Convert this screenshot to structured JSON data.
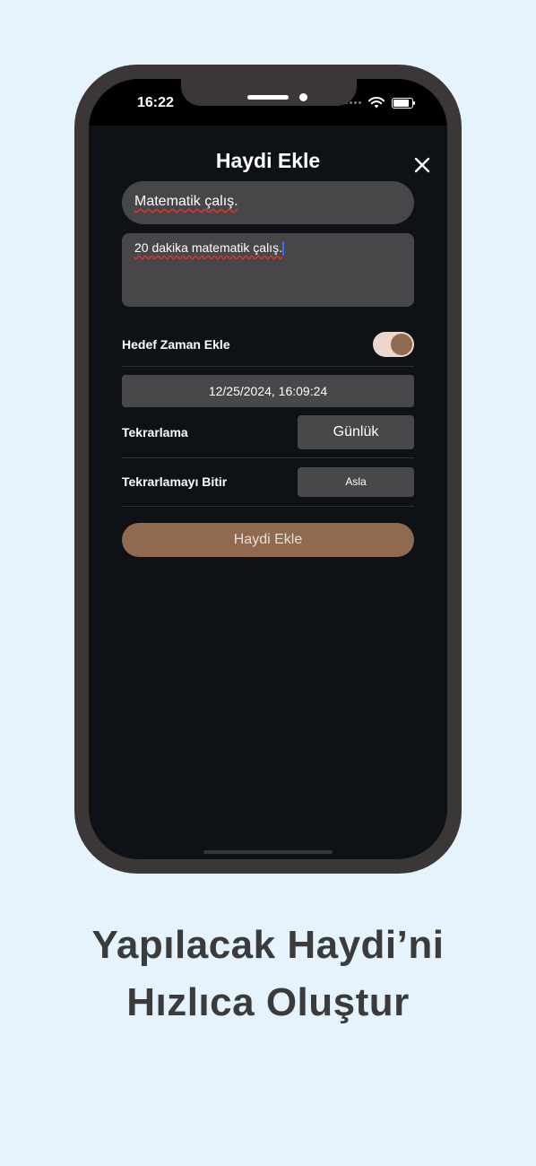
{
  "status_bar": {
    "time": "16:22"
  },
  "modal": {
    "title": "Haydi Ekle",
    "task_title_value": "Matematik çalış.",
    "task_description_value": "20 dakika matematik çalış."
  },
  "rows": {
    "target_time_label": "Hedef Zaman Ekle",
    "target_time_enabled": true,
    "datetime_value": "12/25/2024, 16:09:24",
    "repeat_label": "Tekrarlama",
    "repeat_value": "Günlük",
    "end_repeat_label": "Tekrarlamayı Bitir",
    "end_repeat_value": "Asla"
  },
  "submit_label": "Haydi Ekle",
  "caption": {
    "line1": "Yapılacak Haydi’ni",
    "line2": "Hızlıca Oluştur"
  },
  "colors": {
    "page_bg": "#e5f3fd",
    "screen_bg": "#0e1217",
    "accent_brown": "#8f6a4e",
    "field_bg": "#474749"
  }
}
